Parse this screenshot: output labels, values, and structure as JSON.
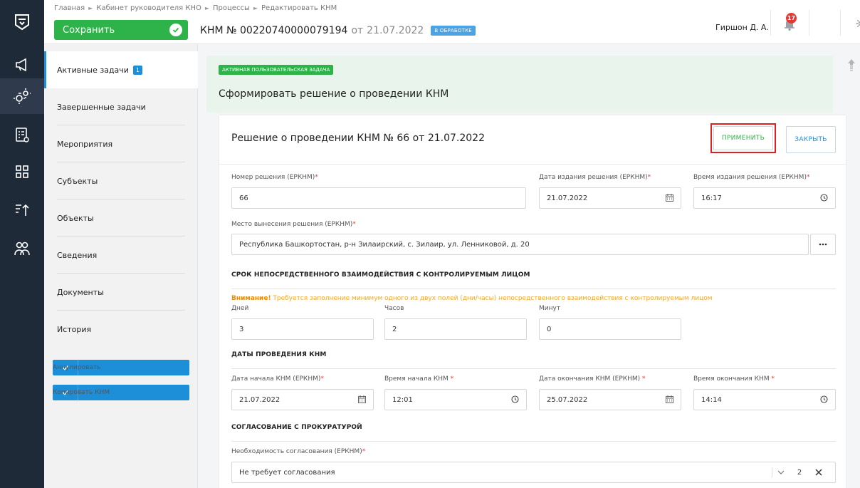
{
  "header": {
    "breadcrumb": [
      "Главная",
      "Кабинет руководителя КНО",
      "Процессы",
      "Редактировать КНМ"
    ],
    "save_label": "Сохранить",
    "knm_prefix": "КНМ № 00220740000079194",
    "knm_from": "от",
    "knm_date": "21.07.2022",
    "status": "В ОБРАБОТКЕ",
    "user_name": "Гиршон Д. А.",
    "notifications": "17"
  },
  "rail": {
    "icons": [
      "logo-icon",
      "megaphone-icon",
      "gears-icon",
      "list-doc-icon",
      "grid-icon",
      "sort-icon",
      "users-icon"
    ]
  },
  "sidebar": {
    "items": [
      {
        "label": "Активные задачи",
        "count": "1"
      },
      {
        "label": "Завершенные задачи"
      },
      {
        "label": "Мероприятия"
      },
      {
        "label": "Субъекты"
      },
      {
        "label": "Объекты"
      },
      {
        "label": "Сведения"
      },
      {
        "label": "Документы"
      },
      {
        "label": "История"
      }
    ],
    "annul_label": "Аннулировать",
    "copy_label": "Копировать КНМ"
  },
  "task": {
    "tag": "АКТИВНАЯ ПОЛЬЗОВАТЕЛЬСКАЯ ЗАДАЧА",
    "title": "Сформировать решение о проведении КНМ"
  },
  "card": {
    "title": "Решение о проведении КНМ № 66 от 21.07.2022",
    "apply_label": "ПРИМЕНИТЬ",
    "close_label": "ЗАКРЫТЬ",
    "decision_number_label": "Номер решения (ЕРКНМ)",
    "decision_number": "66",
    "decision_date_label": "Дата издания решения (ЕРКНМ)",
    "decision_date": "21.07.2022",
    "decision_time_label": "Время издания решения (ЕРКНМ)",
    "decision_time": "16:17",
    "place_label": "Место вынесения решения (ЕРКНМ)",
    "place": "Республика Башкортостан, р-н Зилаирский, с. Зилаир, ул. Ленниковой, д. 20",
    "section_interaction": "СРОК НЕПОСРЕДСТВЕННОГО ВЗАИМОДЕЙСТВИЯ С КОНТРОЛИРУЕМЫМ ЛИЦОМ",
    "warn_bold": "Внимание!",
    "warn_text": " Требуется заполнение минимум одного из двух полей (дни/часы) непосредственного взаимодействия с контролируемым лицом",
    "days_label": "Дней",
    "days": "3",
    "hours_label": "Часов",
    "hours": "2",
    "minutes_label": "Минут",
    "minutes": "0",
    "section_dates": "ДАТЫ ПРОВЕДЕНИЯ КНМ",
    "start_date_label": "Дата начала КНМ (ЕРКНМ)",
    "start_date": "21.07.2022",
    "start_time_label": "Время начала КНМ ",
    "start_time": "12:01",
    "end_date_label": "Дата окончания КНМ (ЕРКНМ) ",
    "end_date": "25.07.2022",
    "end_time_label": "Время окончания КНМ ",
    "end_time": "14:14",
    "section_prosecutor": "СОГЛАСОВАНИЕ С ПРОКУРАТУРОЙ",
    "need_approval_label": "Необходимость согласования (ЕРКНМ)",
    "need_approval": "Не требует согласования",
    "approval_count": "2"
  }
}
